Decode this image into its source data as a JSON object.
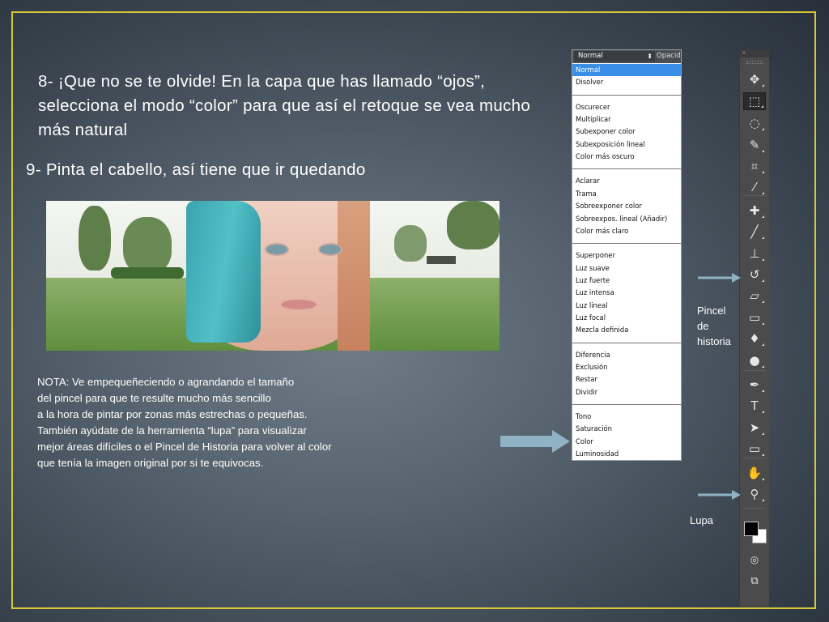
{
  "slide": {
    "step8": "8- ¡Que no se te olvide! En la capa que has llamado “ojos”, selecciona el modo “color” para que así el retoque se vea mucho más natural",
    "step9": "9- Pinta el cabello, así tiene que ir quedando",
    "note_lines": [
      "NOTA: Ve empequeñeciendo o agrandando el tamaño",
      "del pincel para que te resulte mucho más sencillo",
      "a la hora de pintar por zonas más estrechas o pequeñas.",
      "También ayúdate de la herramienta “lupa” para visualizar",
      "mejor áreas difíciles o el Pincel de Historia para volver al color",
      "que tenía la imagen original por si te equivocas."
    ],
    "label_history_brush": [
      "Pincel",
      "de",
      "historia"
    ],
    "label_zoom": "Lupa",
    "frame_color": "#d9c73a"
  },
  "blend_menu": {
    "current": "Normal",
    "opacity_label": "Opacid",
    "selected": "Normal",
    "highlight_color": "#3a8ee6",
    "groups": [
      [
        "Normal",
        "Disolver"
      ],
      [
        "Oscurecer",
        "Multiplicar",
        "Subexponer color",
        "Subexposición lineal",
        "Color más oscuro"
      ],
      [
        "Aclarar",
        "Trama",
        "Sobreexponer color",
        "Sobreexpos. lineal (Añadir)",
        "Color más claro"
      ],
      [
        "Superponer",
        "Luz suave",
        "Luz fuerte",
        "Luz intensa",
        "Luz lineal",
        "Luz focal",
        "Mezcla definida"
      ],
      [
        "Diferencia",
        "Exclusión",
        "Restar",
        "Dividir"
      ],
      [
        "Tono",
        "Saturación",
        "Color",
        "Luminosidad"
      ]
    ]
  },
  "toolbar": {
    "collapse_glyph": "»",
    "tools": [
      {
        "name": "move-tool",
        "glyph": "✥"
      },
      {
        "name": "marquee-tool",
        "glyph": "⬚"
      },
      {
        "name": "lasso-tool",
        "glyph": "◌"
      },
      {
        "name": "quick-selection-tool",
        "glyph": "✎"
      },
      {
        "name": "crop-tool",
        "glyph": "⌗"
      },
      {
        "name": "eyedropper-tool",
        "glyph": "⁄"
      },
      {
        "name": "healing-brush-tool",
        "glyph": "✚"
      },
      {
        "name": "brush-tool",
        "glyph": "╱"
      },
      {
        "name": "clone-stamp-tool",
        "glyph": "⊥"
      },
      {
        "name": "history-brush-tool",
        "glyph": "↺"
      },
      {
        "name": "eraser-tool",
        "glyph": "▱"
      },
      {
        "name": "gradient-tool",
        "glyph": "▭"
      },
      {
        "name": "blur-tool",
        "glyph": "♦"
      },
      {
        "name": "dodge-tool",
        "glyph": "●"
      },
      {
        "name": "pen-tool",
        "glyph": "✒"
      },
      {
        "name": "type-tool",
        "glyph": "T"
      },
      {
        "name": "path-selection-tool",
        "glyph": "➤"
      },
      {
        "name": "rectangle-tool",
        "glyph": "▭"
      },
      {
        "name": "hand-tool",
        "glyph": "✋"
      },
      {
        "name": "zoom-tool",
        "glyph": "⚲"
      }
    ],
    "active_tool": "marquee-tool",
    "foreground_color": "#000000",
    "background_color": "#ffffff",
    "quick_mask_glyph": "◎",
    "screen_mode_glyph": "⧉"
  }
}
